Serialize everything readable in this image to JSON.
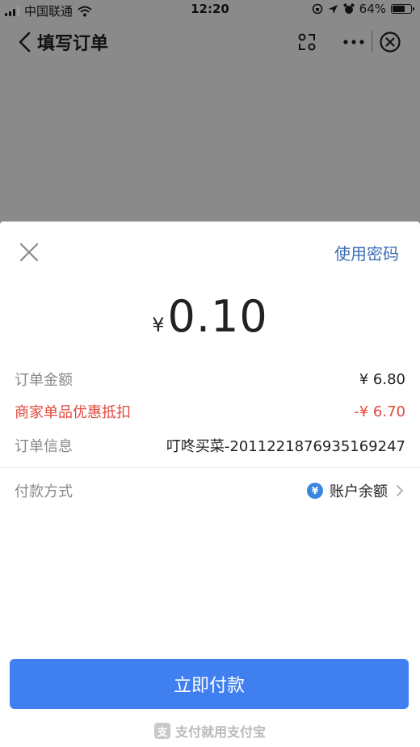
{
  "status_bar": {
    "carrier": "中国联通",
    "time": "12:20",
    "battery": "64%"
  },
  "nav": {
    "title": "填写订单"
  },
  "sheet": {
    "use_password": "使用密码",
    "amount": {
      "currency": "¥",
      "value": "0.10"
    },
    "details": [
      {
        "label": "订单金额",
        "value": "¥ 6.80"
      },
      {
        "label": "商家单品优惠抵扣",
        "value": "-¥ 6.70"
      },
      {
        "label": "订单信息",
        "value": "叮咚买菜-2011221876935169247"
      }
    ],
    "payment": {
      "label": "付款方式",
      "method_icon": "¥",
      "method": "账户余额"
    },
    "pay_button": "立即付款",
    "footer_logo": "支",
    "footer": "支付就用支付宝"
  },
  "colors": {
    "accent": "#3f7ff0",
    "discount": "#e2483c",
    "link": "#3c6fb5"
  }
}
